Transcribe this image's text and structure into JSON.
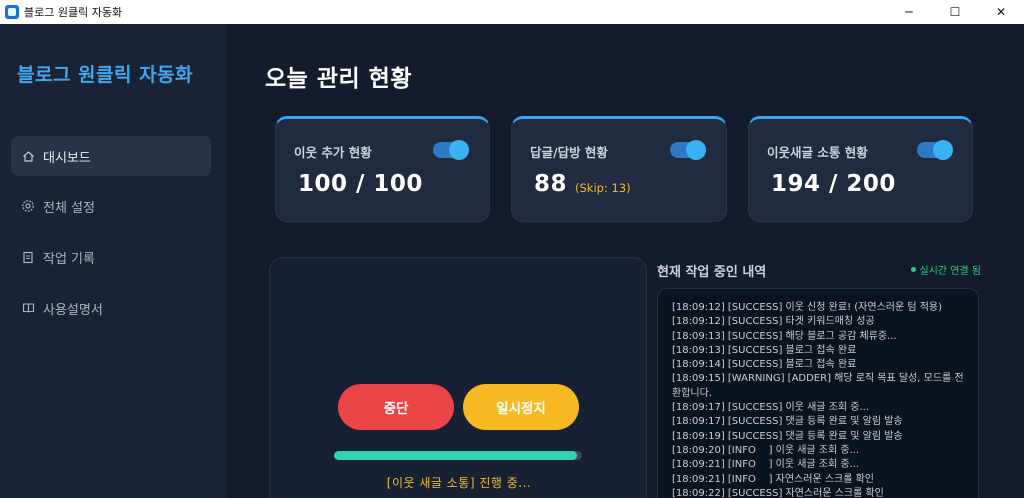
{
  "window": {
    "title": "블로그 원클릭 자동화",
    "minimize": "─",
    "maximize": "☐",
    "close": "✕"
  },
  "sidebar": {
    "brand": "블로그 원클릭 자동화",
    "items": [
      {
        "label": "대시보드",
        "icon": "home-icon",
        "active": true
      },
      {
        "label": "전체 설정",
        "icon": "gear-icon",
        "active": false
      },
      {
        "label": "작업 기록",
        "icon": "document-icon",
        "active": false
      },
      {
        "label": "사용설명서",
        "icon": "book-icon",
        "active": false
      }
    ]
  },
  "main": {
    "title": "오늘 관리 현황",
    "cards": [
      {
        "label": "이웃 추가 현황",
        "value": "100 / 100",
        "toggle_on": true
      },
      {
        "label": "답글/답방 현황",
        "value": "88",
        "skip": "(Skip: 13)",
        "toggle_on": true
      },
      {
        "label": "이웃새글 소통 현황",
        "value": "194 / 200",
        "toggle_on": true
      }
    ],
    "controls": {
      "stop_label": "중단",
      "pause_label": "일시정지",
      "progress": 0.98,
      "status_text": "[이웃 새글 소통] 진행 중..."
    },
    "log": {
      "title": "현재 작업 중인 내역",
      "live_status": "실시간 연결 됨",
      "lines": [
        "[18:09:12] [SUCCESS] 이웃 신청 완료! (자연스러운 텀 적용)",
        "[18:09:12] [SUCCESS] 타겟 키워드매칭 성공",
        "[18:09:13] [SUCCESS] 해당 블로그 공감 체류중...",
        "[18:09:13] [SUCCESS] 블로그 접속 완료",
        "[18:09:14] [SUCCESS] 블로그 접속 완료",
        "[18:09:15] [WARNING] [ADDER] 해당 로직 목표 달성, 모드를 전환합니다.",
        "[18:09:17] [SUCCESS] 이웃 새글 조회 중...",
        "[18:09:17] [SUCCESS] 댓글 등록 완료 및 알림 발송",
        "[18:09:19] [SUCCESS] 댓글 등록 완료 및 알림 발송",
        "[18:09:20] [INFO    ] 이웃 새글 조회 중...",
        "[18:09:21] [INFO    ] 이웃 새글 조회 중...",
        "[18:09:21] [INFO    ] 자연스러운 스크롤 확인",
        "[18:09:22] [SUCCESS] 자연스러운 스크롤 확인"
      ]
    }
  },
  "colors": {
    "accent": "#3aa5f1",
    "stop": "#ea4444",
    "pause": "#f6b922",
    "progress": "#33d3b6",
    "live": "#2fd07d"
  }
}
